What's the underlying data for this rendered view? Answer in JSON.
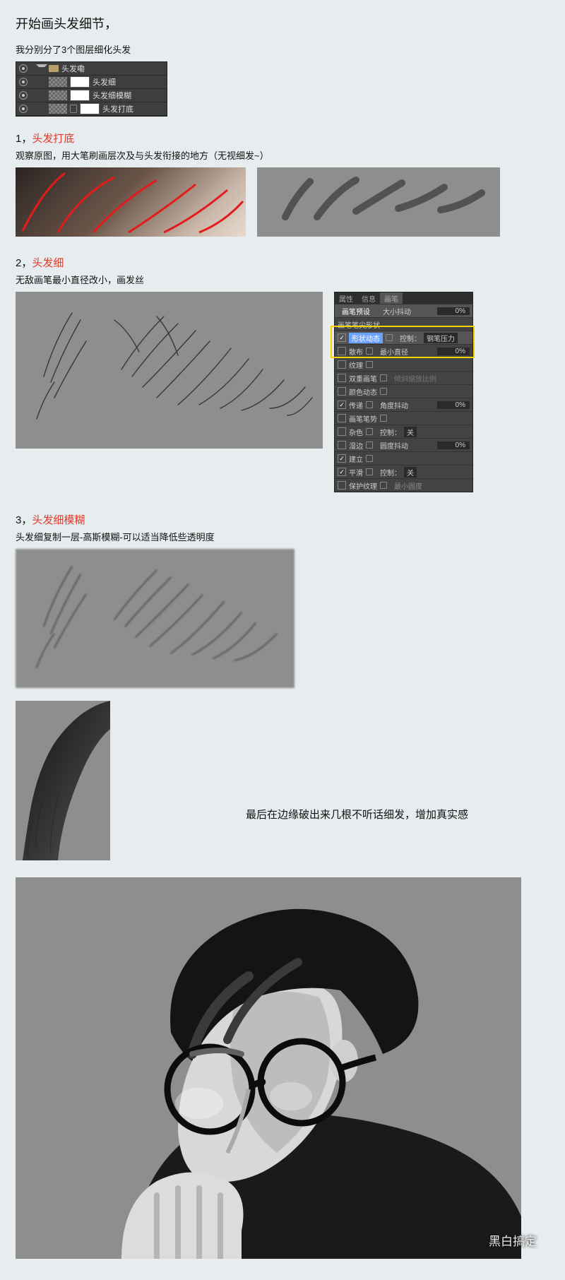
{
  "intro": {
    "title": "开始画头发细节，",
    "subtitle": "我分别分了3个图层细化头发"
  },
  "layers": {
    "group": "头发嘞",
    "rows": [
      "头发细",
      "头发细模糊",
      "头发打底"
    ]
  },
  "step1": {
    "num": "1，",
    "title": "头发打底",
    "hint": "观察原图，用大笔刷画层次及与头发衔接的地方（无视细发~）"
  },
  "step2": {
    "num": "2，",
    "title": "头发细",
    "hint": "无敌画笔最小直径改小，画发丝"
  },
  "brush": {
    "tabs": [
      "属性",
      "信息",
      "画笔"
    ],
    "preset": "画笔预设",
    "header_r": {
      "label": "大小抖动",
      "val": "0%"
    },
    "highlight": {
      "shape": "形状动态",
      "control": "控制：",
      "control_val": "钢笔压力",
      "min": "最小直径",
      "min_val": "0%"
    },
    "opts": [
      "散布",
      "纹理",
      "双重画笔",
      "颜色动态",
      "传递",
      "画笔笔势",
      "杂色",
      "湿边",
      "建立",
      "平滑",
      "保护纹理"
    ],
    "extra": {
      "angle": "角度抖动",
      "angle_val": "0%",
      "ctrl": "控制：",
      "ctrl_val": "关",
      "round": "圆度抖动",
      "round_val": "0%",
      "mindeg": "最小圆度"
    },
    "locks_note": ""
  },
  "step3": {
    "num": "3，",
    "title": "头发细模糊",
    "hint": "头发细复制一层-高斯模糊-可以适当降低些透明度"
  },
  "final_note": "最后在边缘破出来几根不听话细发，增加真实感",
  "watermark": "黑白搞定"
}
